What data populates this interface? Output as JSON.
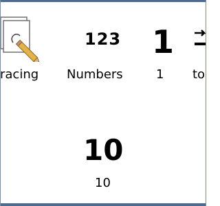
{
  "tiles": [
    {
      "label": "racing",
      "icon": "tracing-pencil-icon"
    },
    {
      "label": "Numbers",
      "icon_text": "123"
    },
    {
      "label": "1",
      "icon_text": "1"
    },
    {
      "label": "to",
      "icon": "arrow-icon"
    },
    {
      "label": "10",
      "icon_text": "10"
    }
  ],
  "colors": {
    "frame": "#4d6b8f",
    "background": "#ffffff",
    "text": "#000000",
    "pencil": "#e3b34a"
  }
}
